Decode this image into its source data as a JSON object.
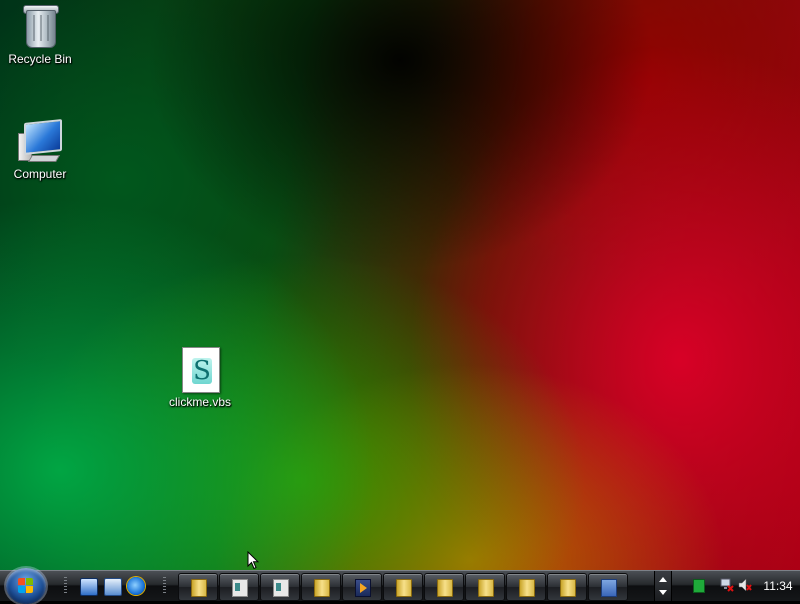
{
  "desktop": {
    "icons": [
      {
        "label": "Recycle Bin",
        "icon": "recycle-bin-icon"
      },
      {
        "label": "Computer",
        "icon": "computer-icon"
      },
      {
        "label": "clickme.vbs",
        "icon": "vbs-script-file-icon"
      }
    ]
  },
  "taskbar": {
    "start": {
      "icon": "windows-start-orb-icon"
    },
    "quick_launch": [
      {
        "icon": "show-desktop-icon"
      },
      {
        "icon": "switch-windows-icon"
      },
      {
        "icon": "internet-explorer-icon"
      }
    ],
    "buttons": [
      {
        "icon": "folder-icon"
      },
      {
        "icon": "window-icon"
      },
      {
        "icon": "window-icon"
      },
      {
        "icon": "folder-icon"
      },
      {
        "icon": "media-player-icon"
      },
      {
        "icon": "folder-icon"
      },
      {
        "icon": "folder-icon"
      },
      {
        "icon": "folder-icon"
      },
      {
        "icon": "folder-icon"
      },
      {
        "icon": "folder-icon"
      },
      {
        "icon": "control-panel-icon"
      }
    ],
    "tray": {
      "icons": [
        "green-status-icon",
        "network-disconnected-icon",
        "volume-muted-icon"
      ],
      "clock": "11:34"
    }
  },
  "colors": {
    "taskbar": "#1a1c1f",
    "desktop_green": "#00a046",
    "desktop_red": "#d0001e"
  }
}
